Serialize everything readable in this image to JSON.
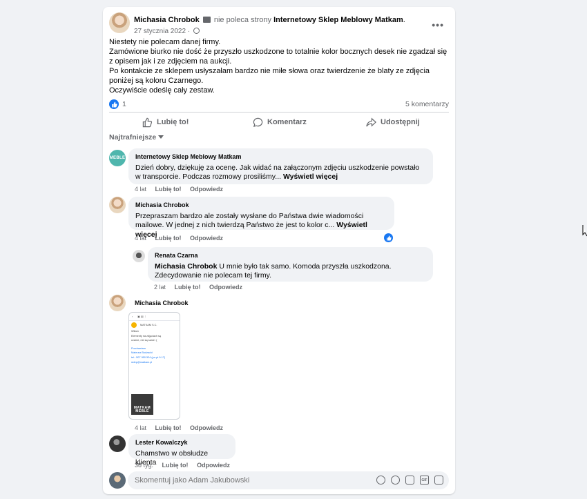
{
  "post": {
    "author": "Michasia Chrobok",
    "action_text": "nie poleca strony",
    "page_name": "Internetowy Sklep Meblowy Matkam",
    "date": "27 stycznia 2022",
    "date_separator": "·",
    "more_label": "•••",
    "body": "Niestety nie polecam danej firmy.\nZamówione biurko nie dość że przyszło uszkodzone to totalnie kolor bocznych desek nie zgadzał się z opisem jak i ze zdjęciem na aukcji.\nPo kontakcie ze sklepem usłyszałam bardzo nie miłe słowa oraz twierdzenie że blaty ze zdjęcia poniżej są koloru Czarnego.\nOczywiście odeślę cały zestaw.",
    "reaction_count": "1",
    "comment_count_label": "5 komentarzy"
  },
  "actions": {
    "like": "Lubię to!",
    "comment": "Komentarz",
    "share": "Udostępnij"
  },
  "sort_label": "Najtrafniejsze",
  "comments": [
    {
      "author": "Internetowy Sklep Meblowy Matkam",
      "text": "Dzień dobry, dziękuję za ocenę. Jak widać na załączonym zdjęciu uszkodzenie powstało w transporcie. Podczas rozmowy prosiliśmy...",
      "see_more": "Wyświetl więcej",
      "age": "4 lat",
      "like": "Lubię to!",
      "reply": "Odpowiedz"
    },
    {
      "author": "Michasia Chrobok",
      "text": "Przepraszam bardzo ale zostały wysłane do Państwa dwie wiadomości mailowe. W jednej z nich twierdzą Państwo że jest to kolor c...",
      "see_more": "Wyświetl więcej",
      "age": "4 lat",
      "like": "Lubię to!",
      "reply": "Odpowiedz"
    },
    {
      "author": "Renata Czarna",
      "mention": "Michasia Chrobok",
      "text": "U mnie było tak samo. Komoda przyszła uszkodzona. Zdecydowanie nie polecam tej firmy.",
      "age": "2 lat",
      "like": "Lubię to!",
      "reply": "Odpowiedz"
    },
    {
      "author": "Michasia Chrobok",
      "age": "4 lat",
      "like": "Lubię to!",
      "reply": "Odpowiedz",
      "attachment": {
        "sender": "MATKAM S.C.",
        "lines": [
          "Witam",
          "Elementy na zdjęciach są",
          "czarne, nie są szare :(",
          "Pozdrawiam",
          "Mateusz Bodzacki",
          "tel.: 507 950 524 (po-pt 9-17)",
          "sklep@matkam.pl"
        ],
        "logo_top": "MATKAM",
        "logo_bottom": "MEBLE"
      }
    },
    {
      "author": "Lester Kowalczyk",
      "text": "Chamstwo w obsłudze klienta",
      "age": "38 tyg.",
      "like": "Lubię to!",
      "reply": "Odpowiedz"
    }
  ],
  "matkam_avatar_text": "MEBLE",
  "compose": {
    "placeholder": "Skomentuj jako Adam Jakubowski"
  },
  "colors": {
    "background": "#f0f2f5",
    "card": "#ffffff",
    "accent": "#1877f2",
    "muted_text": "#65676b",
    "bubble": "#f0f2f5",
    "matkam_avatar": "#4fb6ad"
  },
  "icons": [
    "recommend-icon",
    "globe-icon",
    "more-icon",
    "like-reaction-icon",
    "thumbs-up-icon",
    "comment-icon",
    "share-icon",
    "caret-down-icon",
    "emoji-icon",
    "camera-icon",
    "gif-icon",
    "sticker-icon",
    "avatar-icon",
    "mouse-cursor-icon"
  ]
}
